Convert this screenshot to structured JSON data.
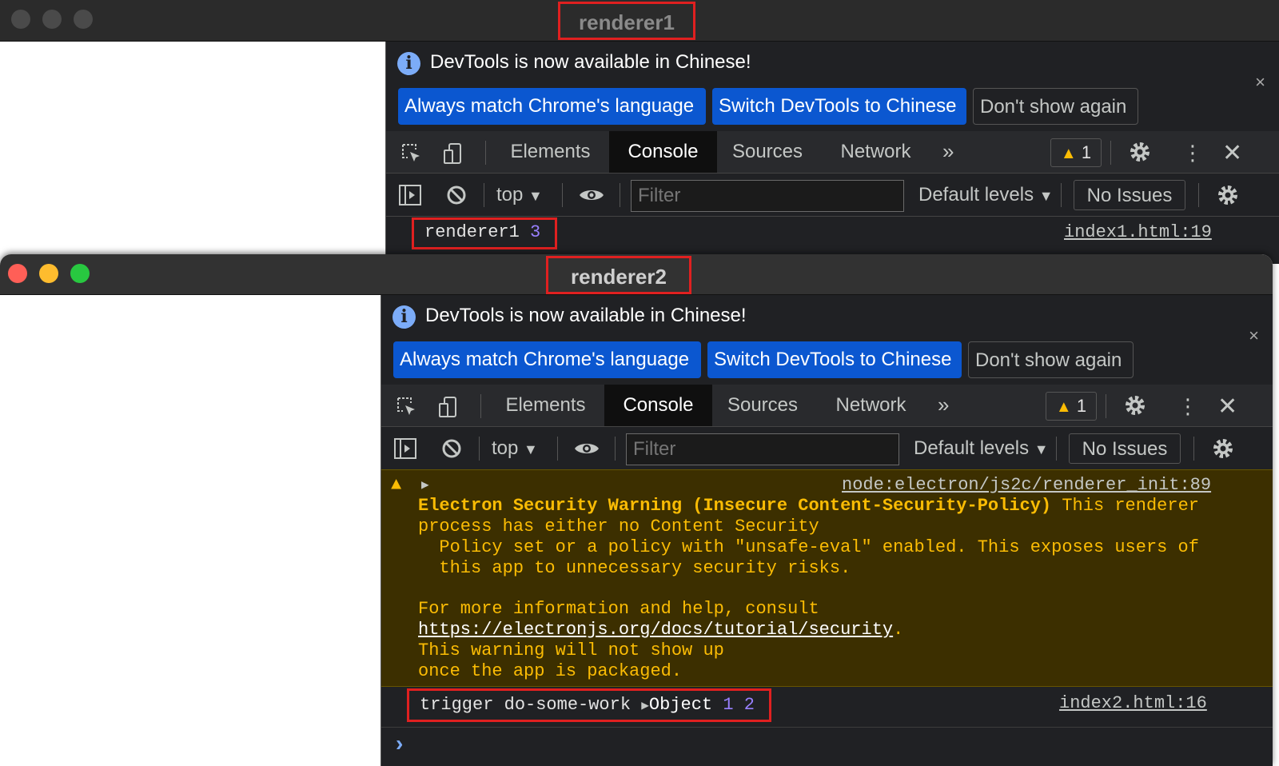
{
  "window1": {
    "title": "renderer1",
    "devtools": {
      "infobar": {
        "message": "DevTools is now available in Chinese!",
        "btn_match": "Always match Chrome's language",
        "btn_switch": "Switch DevTools to Chinese",
        "btn_dont_show": "Don't show again",
        "close": "×"
      },
      "tabs": [
        "Elements",
        "Console",
        "Sources",
        "Network"
      ],
      "more_tabs": "»",
      "warning_count": "1",
      "context": "top",
      "filter_placeholder": "Filter",
      "levels": "Default levels",
      "issues": "No Issues",
      "logs": [
        {
          "text": "renderer1",
          "num": "3",
          "source": "index1.html:19"
        }
      ]
    }
  },
  "window2": {
    "title": "renderer2",
    "devtools": {
      "infobar": {
        "message": "DevTools is now available in Chinese!",
        "btn_match": "Always match Chrome's language",
        "btn_switch": "Switch DevTools to Chinese",
        "btn_dont_show": "Don't show again",
        "close": "×"
      },
      "tabs": [
        "Elements",
        "Console",
        "Sources",
        "Network"
      ],
      "more_tabs": "»",
      "warning_count": "1",
      "context": "top",
      "filter_placeholder": "Filter",
      "levels": "Default levels",
      "issues": "No Issues",
      "warning": {
        "source": "node:electron/js2c/renderer_init:89",
        "title": "Electron Security Warning (Insecure Content-Security-Policy)",
        "line1_rest": " This renderer",
        "line2": "process has either no Content Security",
        "line3": "  Policy set or a policy with \"unsafe-eval\" enabled. This exposes users of",
        "line4": "  this app to unnecessary security risks.",
        "line5": "For more information and help, consult",
        "link": "https://electronjs.org/docs/tutorial/security",
        "link_suffix": ".",
        "line7": "This warning will not show up",
        "line8": "once the app is packaged."
      },
      "log": {
        "text": "trigger do-some-work ",
        "object_label": "Object",
        "num1": "1",
        "num2": "2",
        "source": "index2.html:16"
      },
      "prompt": "›"
    }
  },
  "colors": {
    "highlight": "#e02020",
    "primary_button": "#0b57d0",
    "warning_text": "#fbbc04",
    "warning_bg": "#3c2f00",
    "number": "#9980ff"
  }
}
